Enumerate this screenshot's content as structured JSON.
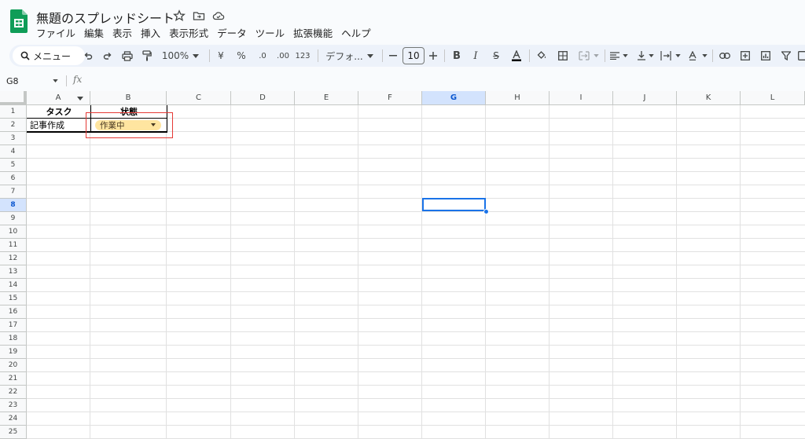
{
  "window": {
    "title": "無題のスプレッドシート"
  },
  "menu": [
    "ファイル",
    "編集",
    "表示",
    "挿入",
    "表示形式",
    "データ",
    "ツール",
    "拡張機能",
    "ヘルプ"
  ],
  "toolbar": {
    "search_label": "メニュー",
    "zoom": "100%",
    "currency": "¥",
    "percent": "%",
    "dec_decrease": ".0",
    "dec_increase": ".00",
    "number_format": "123",
    "font": "デフォ...",
    "font_size": "10"
  },
  "formula_bar": {
    "cell_ref": "G8",
    "fx": "fx"
  },
  "sheet": {
    "columns": [
      "A",
      "B",
      "C",
      "D",
      "E",
      "F",
      "G",
      "H",
      "I",
      "J",
      "K",
      "L"
    ],
    "rows": [
      "1",
      "2",
      "3",
      "4",
      "5",
      "6",
      "7",
      "8",
      "9",
      "10",
      "11",
      "12",
      "13",
      "14",
      "15",
      "16",
      "17",
      "18",
      "19",
      "20",
      "21",
      "22",
      "23",
      "24",
      "25"
    ],
    "selected_cell": "G8",
    "cells": {
      "A1": "タスク",
      "B1": "状態",
      "A2": "記事作成",
      "B2": "作業中"
    }
  },
  "colors": {
    "accent": "#1a73e8",
    "chip_bg": "#ffe5a0",
    "highlight_box": "#e53935",
    "logo_green": "#0f9d58"
  }
}
